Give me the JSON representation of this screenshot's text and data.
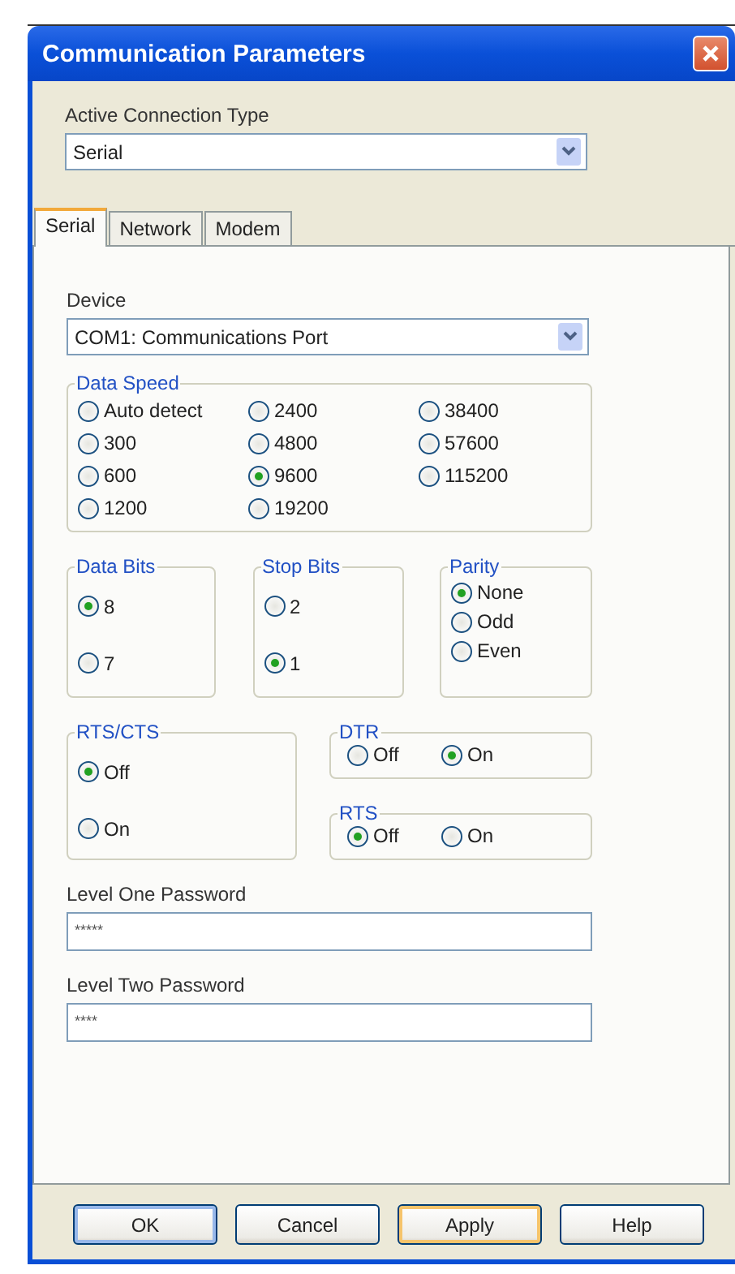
{
  "window": {
    "title": "Communication Parameters"
  },
  "connection_type": {
    "label": "Active Connection Type",
    "value": "Serial"
  },
  "tabs": [
    {
      "label": "Serial",
      "selected": true
    },
    {
      "label": "Network",
      "selected": false
    },
    {
      "label": "Modem",
      "selected": false
    }
  ],
  "device": {
    "label": "Device",
    "value": "COM1: Communications Port"
  },
  "data_speed": {
    "title": "Data Speed",
    "options": [
      {
        "label": "Auto detect",
        "selected": false
      },
      {
        "label": "300",
        "selected": false
      },
      {
        "label": "600",
        "selected": false
      },
      {
        "label": "1200",
        "selected": false
      },
      {
        "label": "2400",
        "selected": false
      },
      {
        "label": "4800",
        "selected": false
      },
      {
        "label": "9600",
        "selected": true
      },
      {
        "label": "19200",
        "selected": false
      },
      {
        "label": "38400",
        "selected": false
      },
      {
        "label": "57600",
        "selected": false
      },
      {
        "label": "115200",
        "selected": false
      }
    ]
  },
  "data_bits": {
    "title": "Data Bits",
    "options": [
      {
        "label": "8",
        "selected": true
      },
      {
        "label": "7",
        "selected": false
      }
    ]
  },
  "stop_bits": {
    "title": "Stop Bits",
    "options": [
      {
        "label": "2",
        "selected": false
      },
      {
        "label": "1",
        "selected": true
      }
    ]
  },
  "parity": {
    "title": "Parity",
    "options": [
      {
        "label": "None",
        "selected": true
      },
      {
        "label": "Odd",
        "selected": false
      },
      {
        "label": "Even",
        "selected": false
      }
    ]
  },
  "rts_cts": {
    "title": "RTS/CTS",
    "options": [
      {
        "label": "Off",
        "selected": true
      },
      {
        "label": "On",
        "selected": false
      }
    ]
  },
  "dtr": {
    "title": "DTR",
    "options": [
      {
        "label": "Off",
        "selected": false
      },
      {
        "label": "On",
        "selected": true
      }
    ]
  },
  "rts": {
    "title": "RTS",
    "options": [
      {
        "label": "Off",
        "selected": true
      },
      {
        "label": "On",
        "selected": false
      }
    ]
  },
  "passwords": [
    {
      "label": "Level One Password",
      "value": "*****"
    },
    {
      "label": "Level Two Password",
      "value": "****"
    }
  ],
  "buttons": [
    {
      "label": "OK",
      "default": true,
      "hovered": false
    },
    {
      "label": "Cancel",
      "default": false,
      "hovered": false
    },
    {
      "label": "Apply",
      "default": false,
      "hovered": true
    },
    {
      "label": "Help",
      "default": false,
      "hovered": false
    }
  ]
}
